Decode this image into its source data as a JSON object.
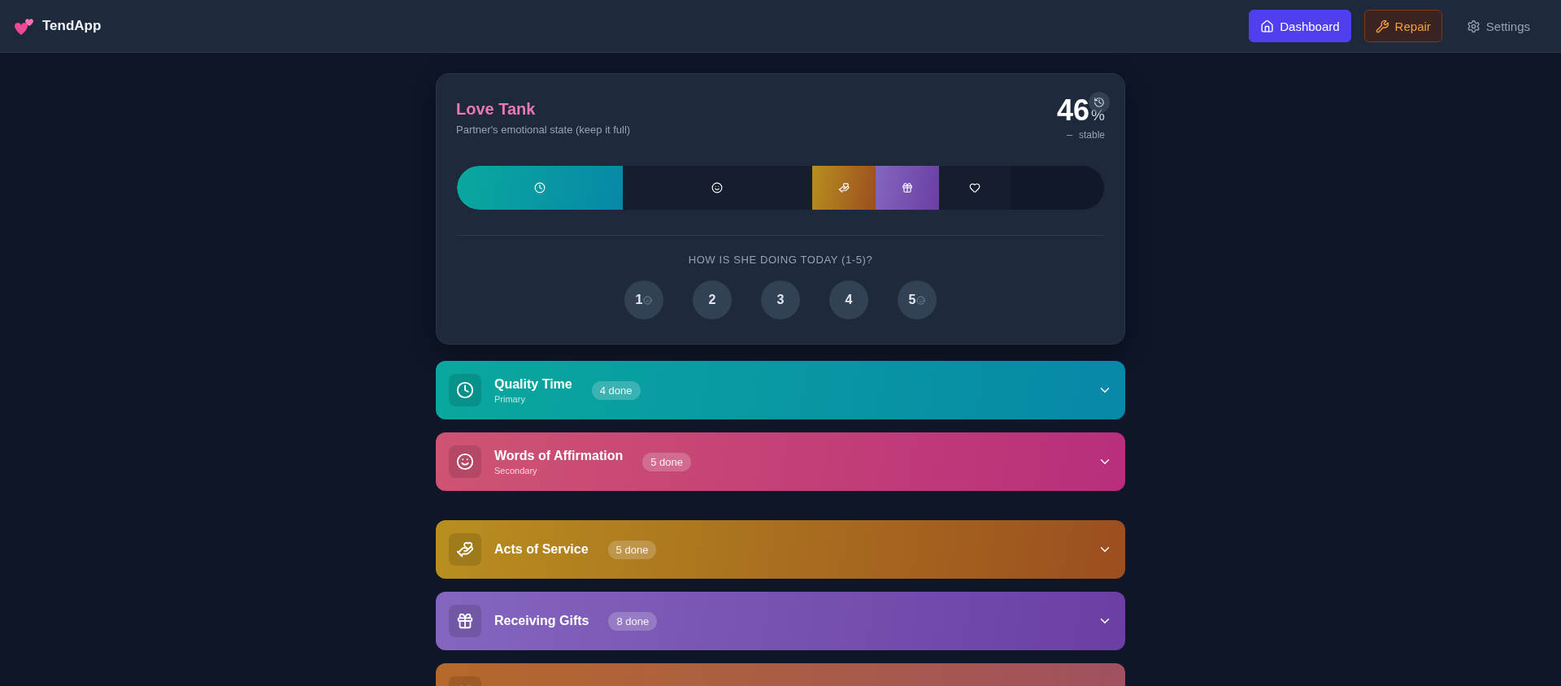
{
  "app": {
    "name": "TendApp"
  },
  "nav": [
    {
      "label": "Dashboard",
      "kind": "page",
      "selected": true
    },
    {
      "label": "Repair",
      "kind": "warning",
      "selected": false
    },
    {
      "label": "Settings",
      "kind": "page",
      "selected": false
    }
  ],
  "tank": {
    "title": "Love Tank",
    "subtitle": "Partner's emotional state (keep it full)",
    "percent": "46",
    "unit": "%",
    "trend": "stable",
    "segments": [
      {
        "kind": "time",
        "filled": true
      },
      {
        "kind": "words",
        "filled": false
      },
      {
        "kind": "service",
        "filled": true
      },
      {
        "kind": "gifts",
        "filled": true
      },
      {
        "kind": "touch",
        "filled": false
      }
    ],
    "question": "HOW IS SHE DOING TODAY (1-5)?",
    "ratings": [
      {
        "label": "1",
        "kind": "sad",
        "selected": false
      },
      {
        "label": "2",
        "kind": "plain",
        "selected": false
      },
      {
        "label": "3",
        "kind": "plain",
        "selected": false
      },
      {
        "label": "4",
        "kind": "plain",
        "selected": false
      },
      {
        "label": "5",
        "kind": "happy",
        "selected": false
      }
    ]
  },
  "groups": [
    [
      {
        "kind": "time",
        "title": "Quality Time",
        "rank": "Primary",
        "badge": "4 done",
        "expanded": false
      },
      {
        "kind": "words",
        "title": "Words of Affirmation",
        "rank": "Secondary",
        "badge": "5 done",
        "expanded": false
      }
    ],
    [
      {
        "kind": "service",
        "title": "Acts of Service",
        "badge": "5 done",
        "expanded": false
      },
      {
        "kind": "gifts",
        "title": "Receiving Gifts",
        "badge": "8 done",
        "expanded": false
      },
      {
        "kind": "touch"
      }
    ]
  ]
}
